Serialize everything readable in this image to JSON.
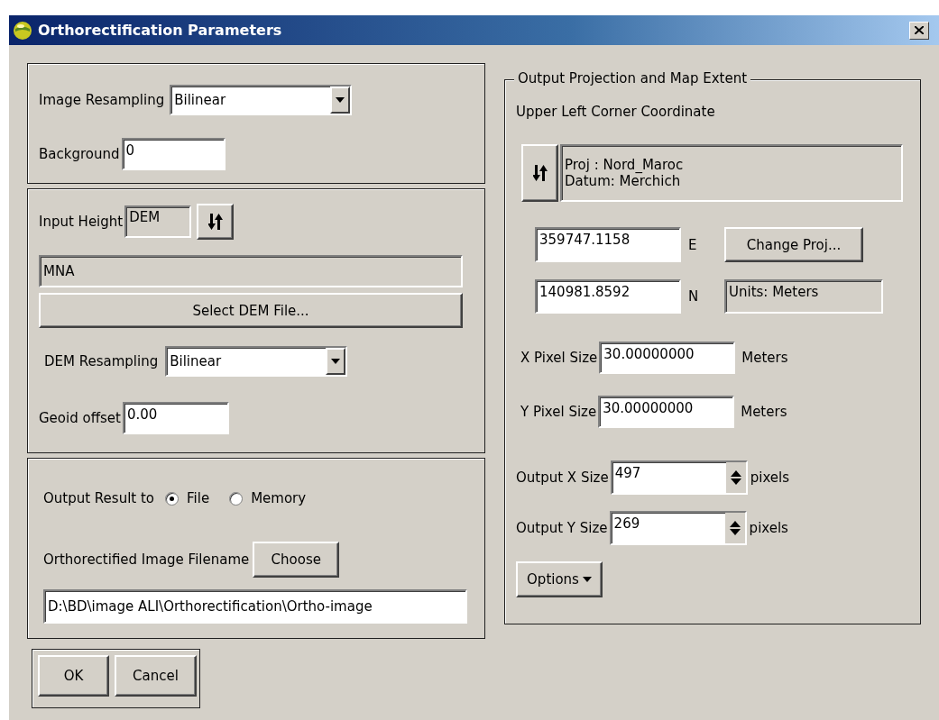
{
  "window": {
    "title": "Orthorectification Parameters"
  },
  "resampling": {
    "image_resampling": {
      "label": "Image Resampling",
      "value": "Bilinear"
    },
    "background": {
      "label": "Background",
      "value": "0"
    }
  },
  "height": {
    "input_height": {
      "label": "Input Height",
      "value": "DEM"
    },
    "dem_name": "MNA",
    "select_button": "Select DEM File...",
    "dem_resampling": {
      "label": "DEM Resampling",
      "value": "Bilinear"
    },
    "geoid_offset": {
      "label": "Geoid offset",
      "value": "0.00"
    }
  },
  "output": {
    "label": "Output Result to",
    "options": [
      {
        "label": "File",
        "selected": true
      },
      {
        "label": "Memory",
        "selected": false
      }
    ],
    "filename_label": "Orthorectified Image Filename",
    "choose_button": "Choose",
    "filename": "D:\\BD\\image ALI\\Orthorectification\\Ortho-image"
  },
  "buttons": [
    "OK",
    "Cancel"
  ],
  "projection": {
    "title": "Output Projection and Map Extent",
    "subtitle": "Upper Left Corner Coordinate",
    "proj_lines": [
      "Proj : Nord_Maroc",
      "Datum: Merchich"
    ],
    "easting": {
      "value": "359747.1158",
      "unit": "E"
    },
    "northing": {
      "value": "140981.8592",
      "unit": "N"
    },
    "change_button": "Change Proj...",
    "units": "Units: Meters",
    "pixel_sizes": [
      {
        "label": "X Pixel Size",
        "value": "30.00000000",
        "unit": "Meters"
      },
      {
        "label": "Y Pixel Size",
        "value": "30.00000000",
        "unit": "Meters"
      }
    ],
    "output_sizes": [
      {
        "label": "Output X Size",
        "value": "497",
        "unit": "pixels"
      },
      {
        "label": "Output Y Size",
        "value": "269",
        "unit": "pixels"
      }
    ],
    "options_button": "Options"
  }
}
